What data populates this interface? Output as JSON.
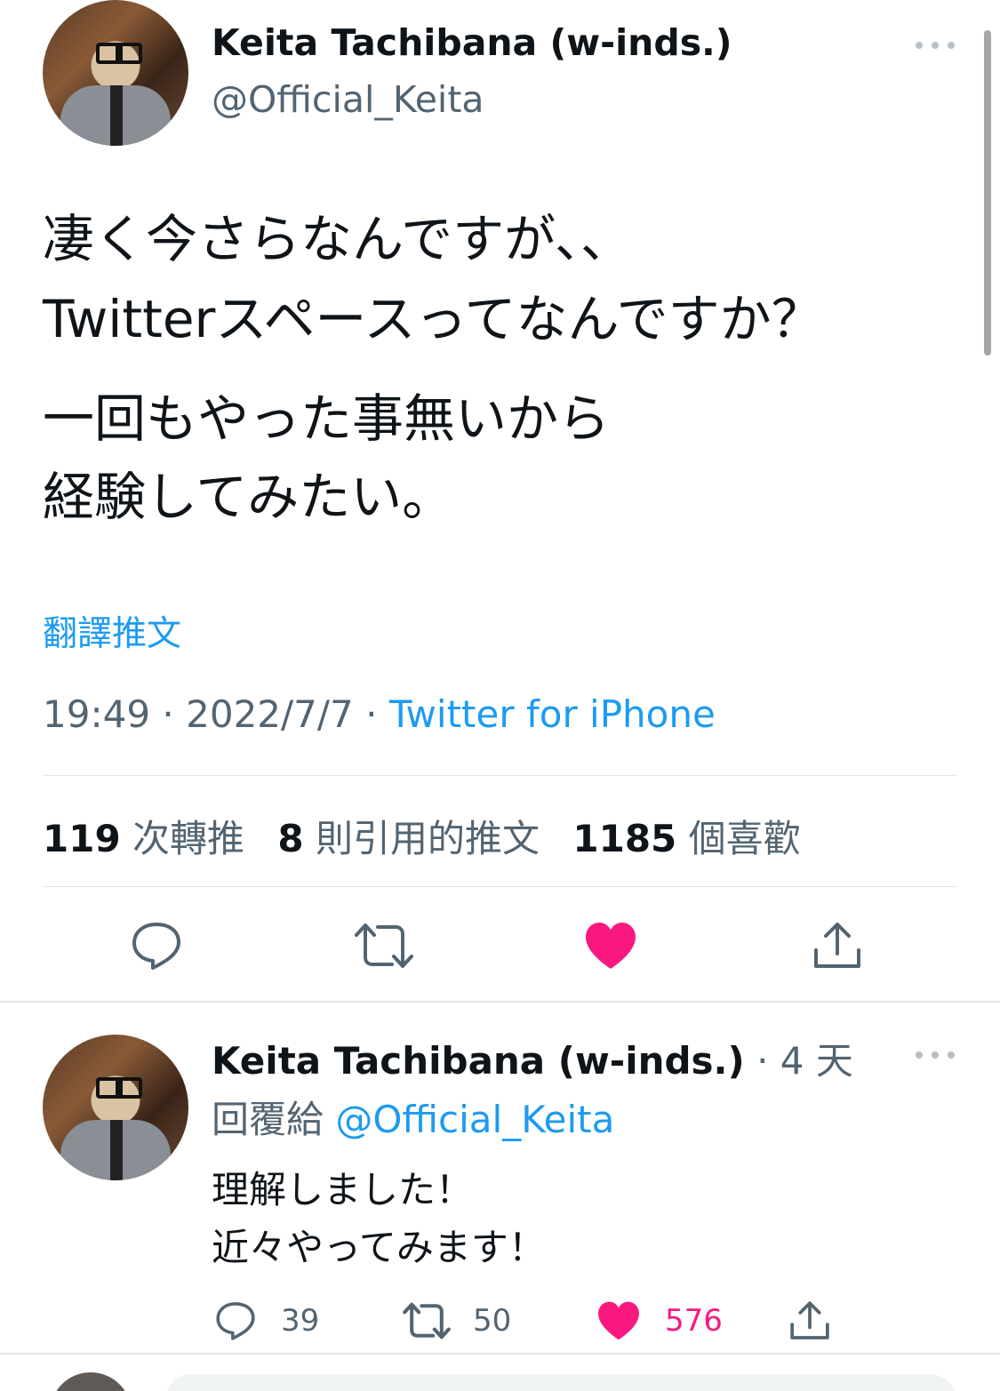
{
  "main_tweet": {
    "author_name": "Keita Tachibana (w-inds.)",
    "handle": "@Official_Keita",
    "more_icon": "ellipsis-icon",
    "text_lines": [
      "凄く今さらなんですが、、",
      "Twitterスペースってなんですか？",
      "一回もやった事無いから",
      "経験してみたい。"
    ],
    "translate_label": "翻譯推文",
    "time": "19:49",
    "separator": "·",
    "date": "2022/7/7",
    "source": "Twitter for iPhone",
    "stats": {
      "retweets_count": "119",
      "retweets_label": "次轉推",
      "quotes_count": "8",
      "quotes_label": "則引用的推文",
      "likes_count": "1185",
      "likes_label": "個喜歡"
    },
    "actions": {
      "reply_icon": "reply-icon",
      "retweet_icon": "retweet-icon",
      "like_icon": "heart-filled-icon",
      "share_icon": "share-icon"
    },
    "like_color": "#f91880"
  },
  "reply_tweet": {
    "author_name": "Keita Tachibana (w-inds.)",
    "separator": "·",
    "time": "4 天",
    "replying_to_label": "回覆給",
    "replying_to_handle": "@Official_Keita",
    "text_lines": [
      "理解しました！",
      "近々やってみます！"
    ],
    "reply_count": "39",
    "retweet_count": "50",
    "like_count": "576",
    "like_color": "#f91880"
  },
  "colors": {
    "link": "#1d9bf0",
    "secondary_text": "#536471",
    "primary_text": "#0f1419",
    "like": "#f91880"
  }
}
